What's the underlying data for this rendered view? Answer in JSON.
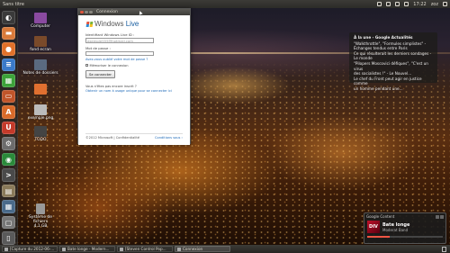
{
  "top_panel": {
    "title": "Sans titre",
    "time": "17:22",
    "user": "zoz"
  },
  "launcher": {
    "icons": [
      {
        "name": "dash-icon",
        "color": "#3a3a3a",
        "glyph": "◐"
      },
      {
        "name": "home-folder-icon",
        "color": "#d97a3a",
        "glyph": "▬"
      },
      {
        "name": "firefox-icon",
        "color": "#e0712a",
        "glyph": "●"
      },
      {
        "name": "libreoffice-writer-icon",
        "color": "#3a7ac9",
        "glyph": "≡"
      },
      {
        "name": "libreoffice-calc-icon",
        "color": "#3da33a",
        "glyph": "▦"
      },
      {
        "name": "libreoffice-impress-icon",
        "color": "#c0552a",
        "glyph": "▭"
      },
      {
        "name": "ubuntu-software-icon",
        "color": "#d96a2a",
        "glyph": "A"
      },
      {
        "name": "ubuntu-one-icon",
        "color": "#c43a2a",
        "glyph": "U"
      },
      {
        "name": "settings-icon",
        "color": "#6c6c6c",
        "glyph": "⚙"
      },
      {
        "name": "chrome-icon",
        "color": "#2a8a3a",
        "glyph": "◉"
      },
      {
        "name": "terminal-icon",
        "color": "#4a4a4a",
        "glyph": ">"
      },
      {
        "name": "files-icon",
        "color": "#8a7a5a",
        "glyph": "▤"
      },
      {
        "name": "workspace-switcher-icon",
        "color": "#4a6a8a",
        "glyph": "▦"
      },
      {
        "name": "disk-icon",
        "color": "#777777",
        "glyph": "▢"
      },
      {
        "name": "trash-icon",
        "color": "#5a5a5a",
        "glyph": "▯"
      }
    ]
  },
  "desktop_icons": [
    {
      "label": "Computer",
      "color": "#8a4aa0"
    },
    {
      "label": "fond ecran",
      "color": "#7a4a2a"
    },
    {
      "label": "Notes de dossiers",
      "color": "#5a6a80"
    },
    {
      "label": "",
      "color": "#e07030"
    },
    {
      "label": "exemple.png",
      "color": "#bbbbbb"
    },
    {
      "label": "TODO",
      "color": "#444444"
    },
    {
      "label": "Système de fichiers",
      "sub": "4,1 GB",
      "color": "#999999"
    }
  ],
  "dialog": {
    "window_title": "Connexion",
    "logo_word": "Windows",
    "logo_word2": "Live",
    "field1_label": "Identifiant Windows Live ID :",
    "field1_placeholder": "exemple555@hotmail.com",
    "field2_label": "Mot de passe :",
    "forgot_link": "Avez-vous oublié votre mot de passe ?",
    "remember_label": "Mémoriser le connexion",
    "connect_button": "Se connecter",
    "no_account_text": "Vous n'êtes pas encore inscrit ?",
    "signup_link": "Obtenir un nom à usage unique pour se connecter ici",
    "footer_left": "©2012 Microsoft | Confidentialité",
    "footer_right": "Conditions sous ›"
  },
  "news": {
    "header": "À la une - Google Actualités",
    "lines": [
      "\"Walkthrottle\", \"Formules simplistes\" -",
      "Échanges tendus entre Paris",
      "Ce qui résulterait les derniers sondages -",
      "Le monde",
      "\"Pilopers Moscovici défiques\", \"C'est un virus",
      "des socialistes !\" - Le Nouvel...",
      "Le chef du Front peut agir en justice comme",
      "un homme pendant une..."
    ]
  },
  "music": {
    "search_label": "Google Content",
    "cover_text": "DIV",
    "track": "Bate longe",
    "artist": "Moderat Band",
    "progress": 0.3
  },
  "taskbar": {
    "tasks": [
      {
        "label": "[Capture du 2012-06-...",
        "active": false
      },
      {
        "label": "Bate longe - Modern...",
        "active": false
      },
      {
        "label": "[Steven Control Pop...",
        "active": false
      },
      {
        "label": "Connexion",
        "active": true
      }
    ]
  }
}
